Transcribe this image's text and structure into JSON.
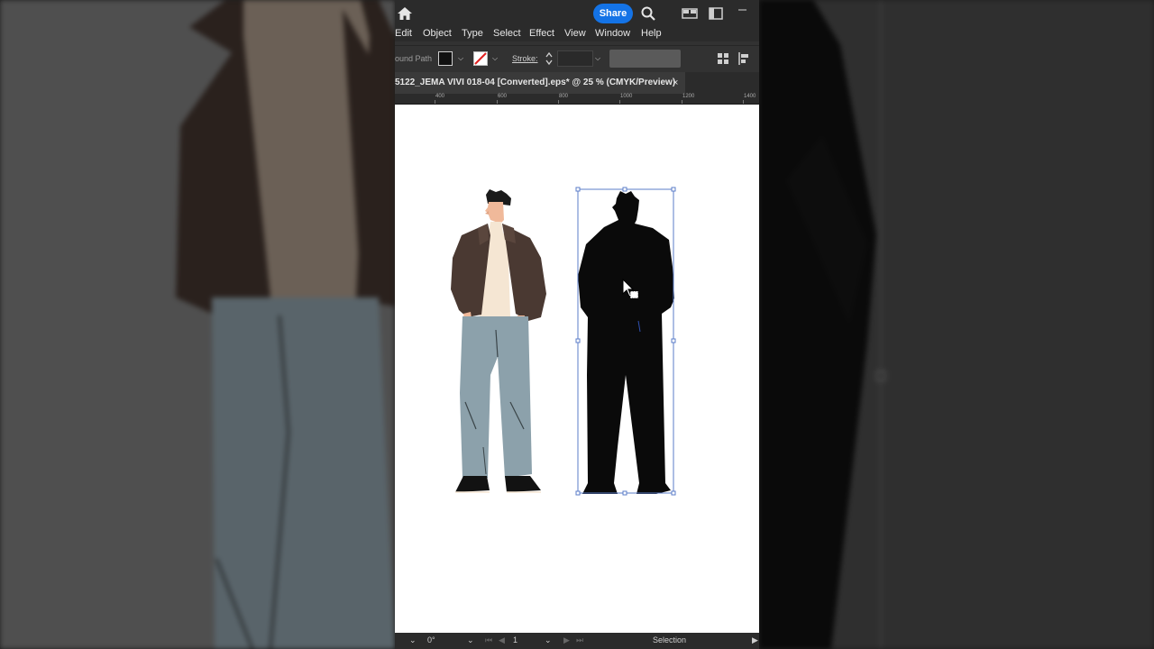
{
  "titlebar": {
    "share_label": "Share",
    "icons": [
      "home-icon",
      "search-icon",
      "arrange-documents-icon",
      "workspace-icon",
      "minimize-icon"
    ]
  },
  "menu": {
    "items": [
      "Edit",
      "Object",
      "Type",
      "Select",
      "Effect",
      "View",
      "Window",
      "Help"
    ]
  },
  "control_bar": {
    "object_type": "ound Path",
    "stroke_label": "Stroke:",
    "fill_color": "#111111",
    "stroke_color": "none"
  },
  "document": {
    "tab_title": "5122_JEMA VIVI 018-04 [Converted].eps* @ 25 % (CMYK/Preview)",
    "close_label": "×"
  },
  "ruler": {
    "labels": [
      "400",
      "600",
      "800",
      "1000",
      "1200",
      "1400"
    ]
  },
  "status": {
    "rotation": "0°",
    "artboard": "1",
    "tool": "Selection"
  },
  "colors": {
    "accent": "#1473e6",
    "selection": "#5b7cc8",
    "jacket": "#4a3932",
    "shirt": "#f5e6d3",
    "pants": "#8ca1ab",
    "silhouette": "#0a0a0a"
  }
}
